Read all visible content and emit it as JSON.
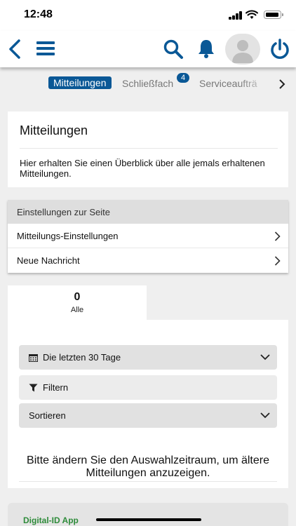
{
  "status_bar": {
    "time": "12:48"
  },
  "header": {
    "icons": [
      "back-icon",
      "menu-icon",
      "search-icon",
      "bell-icon",
      "avatar",
      "power-icon"
    ],
    "accent_color": "#0a5896"
  },
  "tabs": {
    "active": "Mitteilungen",
    "items": [
      "Mitteilungen",
      "Schließfach",
      "Serviceaufträ"
    ],
    "badge": "4"
  },
  "intro": {
    "title": "Mitteilungen",
    "text": "Hier erhalten Sie einen Überblick über alle jemals erhaltenen Mitteilungen."
  },
  "settings": {
    "heading": "Einstellungen zur Seite",
    "rows": [
      "Mitteilungs-Einstellungen",
      "Neue Nachricht"
    ]
  },
  "counts": {
    "value": "0",
    "label": "Alle"
  },
  "filters": {
    "period": "Die letzten 30 Tage",
    "filter": "Filtern",
    "sort": "Sortieren"
  },
  "notice": "Bitte ändern Sie den Auswahlzeitraum, um ältere Mitteilungen anzuzeigen.",
  "bottom": {
    "title": "Digital-ID App",
    "title_color": "#2e8b3a"
  }
}
